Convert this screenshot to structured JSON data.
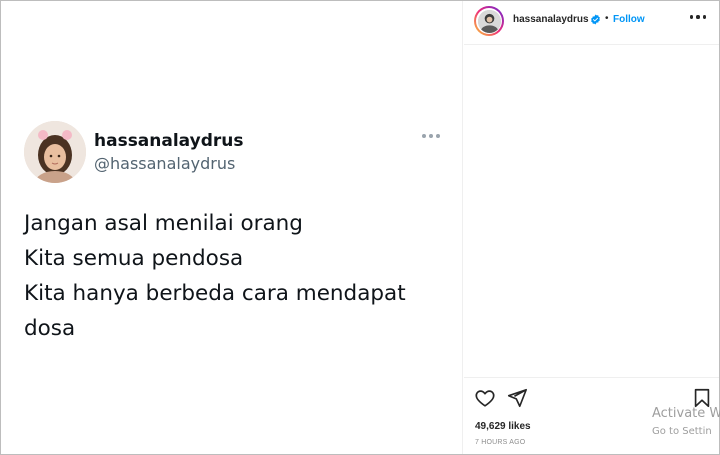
{
  "post": {
    "tweet": {
      "display_name": "hassanalaydrus",
      "handle": "@hassanalaydrus",
      "lines": [
        "Jangan asal menilai orang",
        "Kita semua pendosa",
        "Kita hanya berbeda cara mendapat",
        "dosa"
      ]
    }
  },
  "header": {
    "username": "hassanalaydrus",
    "separator": "•",
    "follow_label": "Follow",
    "verified_icon": "verified-badge-icon",
    "accent_color": "#0095f6"
  },
  "actions": {
    "icons": [
      "heart-icon",
      "share-icon",
      "save-icon"
    ],
    "likes": "49,629 likes",
    "timestamp": "7 HOURS AGO"
  },
  "watermark": {
    "title": "Activate W",
    "subtitle": "Go to Settin"
  }
}
